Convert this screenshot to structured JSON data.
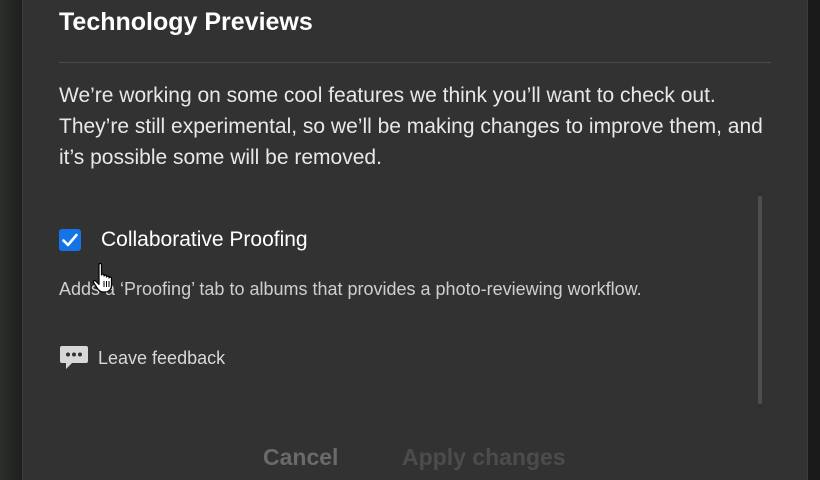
{
  "dialog": {
    "title": "Technology Previews",
    "description": "We’re working on some cool features we think you’ll want to check out. They’re still experimental, so we’ll be making changes to improve them, and it’s possible some will be removed."
  },
  "feature": {
    "name": "Collaborative Proofing",
    "checked": true,
    "description": "Adds a ‘Proofing’ tab to albums that provides a photo-reviewing workflow.",
    "feedback_label": "Leave feedback"
  },
  "footer": {
    "cancel_label": "Cancel",
    "apply_label": "Apply changes"
  },
  "colors": {
    "accent": "#1473e6",
    "dialog_bg": "#323232"
  },
  "icons": {
    "checkbox": "checkmark-icon",
    "feedback": "chat-bubble-icon",
    "cursor": "hand-pointer-icon"
  }
}
